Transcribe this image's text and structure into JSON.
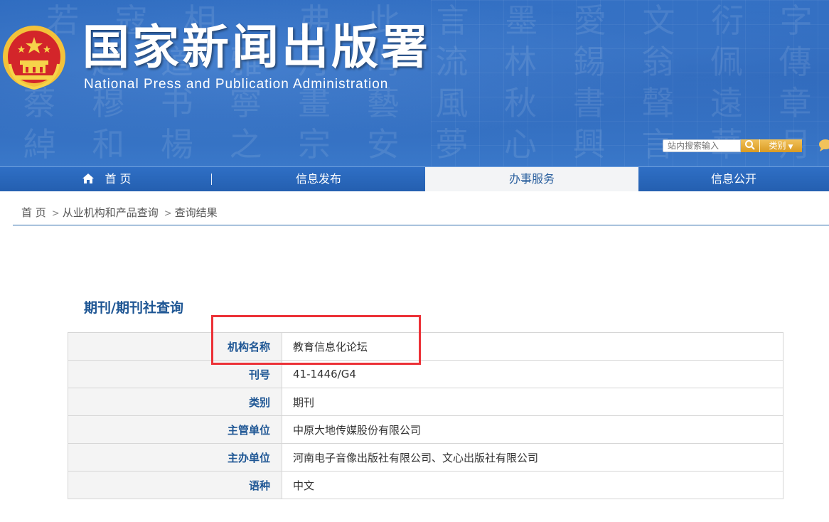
{
  "header": {
    "title": "国家新闻出版署",
    "subtitle": "National  Press and Publication Administration",
    "search_placeholder": "站内搜索输入",
    "search_category": "类别"
  },
  "nav": {
    "items": [
      {
        "label": "首 页"
      },
      {
        "label": "信息发布"
      },
      {
        "label": "办事服务"
      },
      {
        "label": "信息公开"
      }
    ],
    "active_index": 2
  },
  "breadcrumb": {
    "items": [
      "首 页",
      "从业机构和产品查询",
      "查询结果"
    ],
    "separator": ">"
  },
  "section": {
    "title": "期刊/期刊社查询"
  },
  "table": {
    "rows": [
      {
        "label": "机构名称",
        "value": "教育信息化论坛"
      },
      {
        "label": "刊号",
        "value": "41-1446/G4"
      },
      {
        "label": "类别",
        "value": "期刊"
      },
      {
        "label": "主管单位",
        "value": "中原大地传媒股份有限公司"
      },
      {
        "label": "主办单位",
        "value": "河南电子音像出版社有限公司、文心出版社有限公司"
      },
      {
        "label": "语种",
        "value": "中文"
      }
    ]
  },
  "colors": {
    "banner_blue": "#2a63b6",
    "nav_blue": "#245fb0",
    "label_blue": "#1e5694",
    "highlight_red": "#ec3137",
    "search_gold": "#d99a22"
  },
  "icons": {
    "emblem": "national-emblem-icon",
    "search": "search-icon",
    "home": "home-icon",
    "chat": "chat-bubble-icon"
  }
}
